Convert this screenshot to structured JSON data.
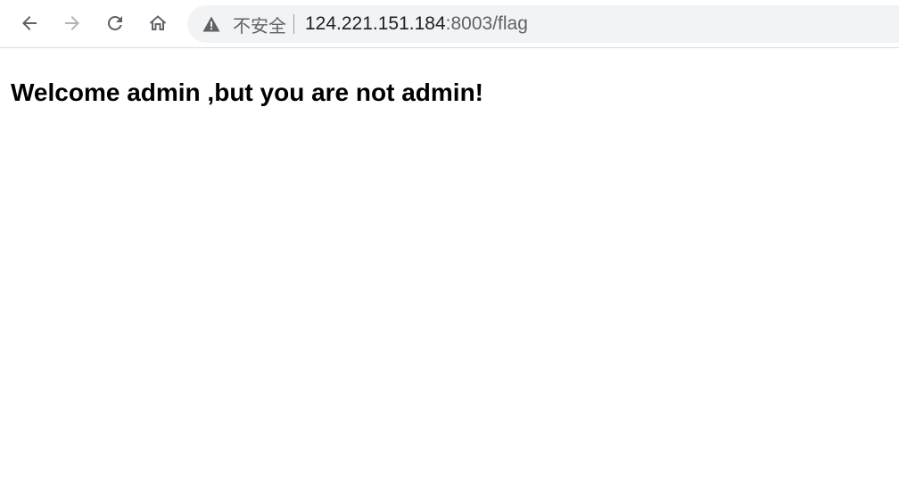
{
  "toolbar": {
    "back_icon": "arrow-left-icon",
    "forward_icon": "arrow-right-icon",
    "reload_icon": "reload-icon",
    "home_icon": "home-icon"
  },
  "omnibox": {
    "security_icon": "warning-triangle-icon",
    "security_label": "不安全",
    "url_host": "124.221.151.184",
    "url_rest": ":8003/flag"
  },
  "page": {
    "heading": "Welcome admin ,but you are not admin!"
  },
  "colors": {
    "icon_active": "#5f6368",
    "icon_disabled": "#b3b3b3",
    "omnibox_bg": "#f1f3f4",
    "text": "#000000"
  }
}
